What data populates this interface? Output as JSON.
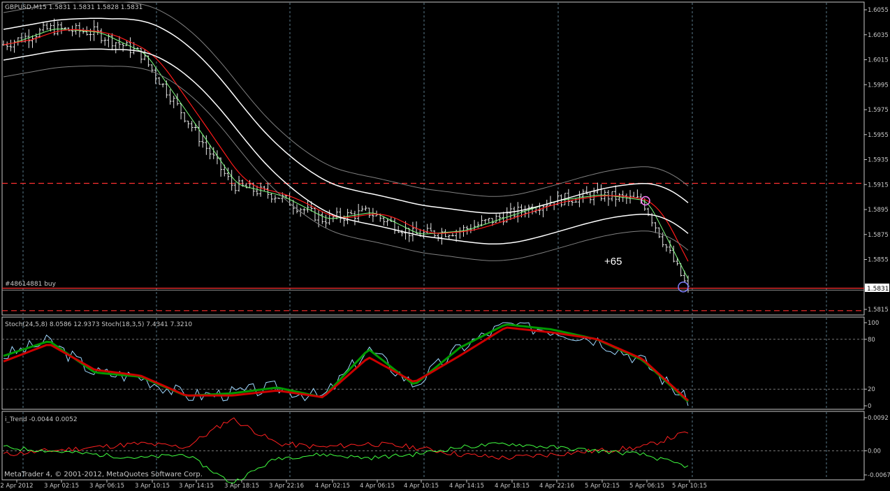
{
  "header": {
    "symbol_info": "GBPUSD,M15  1.5831 1.5831 1.5828 1.5831"
  },
  "price_panel": {
    "order_label": "#48614881 buy",
    "current_price_label": "1.5831",
    "profit_label": "+65",
    "y_ticks": [
      "1.6055",
      "1.6035",
      "1.6015",
      "1.5995",
      "1.5975",
      "1.5955",
      "1.5935",
      "1.5915",
      "1.5895",
      "1.5875",
      "1.5855",
      "1.5815"
    ],
    "y_tick_values": [
      1.6055,
      1.6035,
      1.6015,
      1.5995,
      1.5975,
      1.5955,
      1.5935,
      1.5915,
      1.5895,
      1.5875,
      1.5855,
      1.5815
    ]
  },
  "stoch_panel": {
    "label": "Stoch(24,5,8) 8.0586 12.9373  Stoch(18,3,5) 7.4341 7.3210",
    "y_ticks": [
      "100",
      "80",
      "20",
      "0"
    ]
  },
  "trend_panel": {
    "label": "i_Trend -0.0044 0.0052",
    "y_ticks": [
      "0.0092",
      "0.00",
      "-0.0067"
    ]
  },
  "footer": {
    "copyright": "MetaTrader 4, © 2001-2012, MetaQuotes Software Corp."
  },
  "x_ticks": [
    "2 Apr 2012",
    "3 Apr 02:15",
    "3 Apr 06:15",
    "3 Apr 10:15",
    "3 Apr 14:15",
    "3 Apr 18:15",
    "3 Apr 22:16",
    "4 Apr 02:15",
    "4 Apr 06:15",
    "4 Apr 10:15",
    "4 Apr 14:15",
    "4 Apr 18:15",
    "4 Apr 22:16",
    "5 Apr 02:15",
    "5 Apr 06:15",
    "5 Apr 10:15"
  ],
  "colors": {
    "background": "#000000",
    "border": "#c8c8c8",
    "candle": "#e8e8e8",
    "ma_fast": "#ff1a1a",
    "ma_white": "#ffffff",
    "envelope": "#808080",
    "price_green": "#80ff80",
    "order_line": "#ff3030",
    "stoch_green": "#009900",
    "stoch_red": "#cc0000",
    "grid": "#5a7a8a"
  },
  "chart_data": [
    {
      "type": "line",
      "name": "GBPUSD,M15",
      "x": [
        "2 Apr 2012",
        "3 Apr 02:15",
        "3 Apr 06:15",
        "3 Apr 10:15",
        "3 Apr 14:15",
        "3 Apr 18:15",
        "3 Apr 22:16",
        "4 Apr 02:15",
        "4 Apr 06:15",
        "4 Apr 10:15",
        "4 Apr 14:15",
        "4 Apr 18:15",
        "4 Apr 22:16",
        "5 Apr 02:15",
        "5 Apr 06:15",
        "5 Apr 10:15"
      ],
      "series": [
        {
          "name": "close",
          "values": [
            1.6027,
            1.604,
            1.6037,
            1.602,
            1.5968,
            1.5915,
            1.5906,
            1.5887,
            1.5893,
            1.5875,
            1.5878,
            1.589,
            1.5902,
            1.5907,
            1.5902,
            1.5831
          ]
        }
      ],
      "ylim": [
        1.581,
        1.606
      ]
    },
    {
      "type": "line",
      "name": "Stoch(24,5,8)",
      "x": [
        "2 Apr 2012",
        "3 Apr 02:15",
        "3 Apr 06:15",
        "3 Apr 10:15",
        "3 Apr 14:15",
        "3 Apr 18:15",
        "3 Apr 22:16",
        "4 Apr 02:15",
        "4 Apr 06:15",
        "4 Apr 10:15",
        "4 Apr 14:15",
        "4 Apr 18:15",
        "4 Apr 22:16",
        "5 Apr 02:15",
        "5 Apr 06:15",
        "5 Apr 10:15"
      ],
      "series": [
        {
          "name": "main",
          "values": [
            60,
            78,
            40,
            35,
            12,
            15,
            22,
            10,
            68,
            25,
            70,
            98,
            92,
            80,
            55,
            5
          ]
        },
        {
          "name": "signal",
          "values": [
            55,
            76,
            45,
            38,
            14,
            14,
            20,
            12,
            60,
            30,
            62,
            96,
            90,
            82,
            58,
            8
          ]
        }
      ],
      "ylim": [
        0,
        100
      ]
    },
    {
      "type": "line",
      "name": "i_Trend",
      "x": [
        "2 Apr 2012",
        "3 Apr 02:15",
        "3 Apr 06:15",
        "3 Apr 10:15",
        "3 Apr 14:15",
        "3 Apr 18:15",
        "3 Apr 22:16",
        "4 Apr 02:15",
        "4 Apr 06:15",
        "4 Apr 10:15",
        "4 Apr 14:15",
        "4 Apr 18:15",
        "4 Apr 22:16",
        "5 Apr 02:15",
        "5 Apr 06:15",
        "5 Apr 10:15"
      ],
      "series": [
        {
          "name": "red",
          "values": [
            -0.001,
            0.0,
            0.001,
            0.002,
            0.001,
            0.009,
            0.002,
            0.001,
            0.002,
            0.001,
            -0.001,
            -0.002,
            -0.001,
            0.0,
            0.001,
            0.0052
          ]
        },
        {
          "name": "green",
          "values": [
            0.001,
            0.0,
            -0.001,
            -0.002,
            -0.001,
            -0.009,
            -0.002,
            -0.001,
            -0.002,
            -0.001,
            0.001,
            0.002,
            0.001,
            0.0,
            -0.001,
            -0.0044
          ]
        }
      ],
      "ylim": [
        -0.0067,
        0.0092
      ]
    }
  ]
}
